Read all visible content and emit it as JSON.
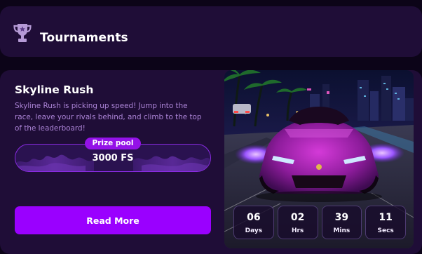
{
  "header": {
    "title": "Tournaments",
    "icon": "trophy-icon"
  },
  "tournament": {
    "title": "Skyline Rush",
    "description": "Skyline Rush is picking up speed! Jump into the race, leave your rivals behind, and climb to the top of the leaderboard!",
    "prize_label": "Prize pool",
    "prize_value": "3000 FS",
    "cta_label": "Read More",
    "image": "neon-sports-car-city-night"
  },
  "countdown": [
    {
      "value": "06",
      "unit": "Days"
    },
    {
      "value": "02",
      "unit": "Hrs"
    },
    {
      "value": "39",
      "unit": "Mins"
    },
    {
      "value": "11",
      "unit": "Secs"
    }
  ],
  "colors": {
    "page_bg": "#0c0418",
    "panel_bg": "#1f0d37",
    "accent": "#9a00ff",
    "description_text": "#ad85d8",
    "prize_border": "#8a2be2"
  }
}
